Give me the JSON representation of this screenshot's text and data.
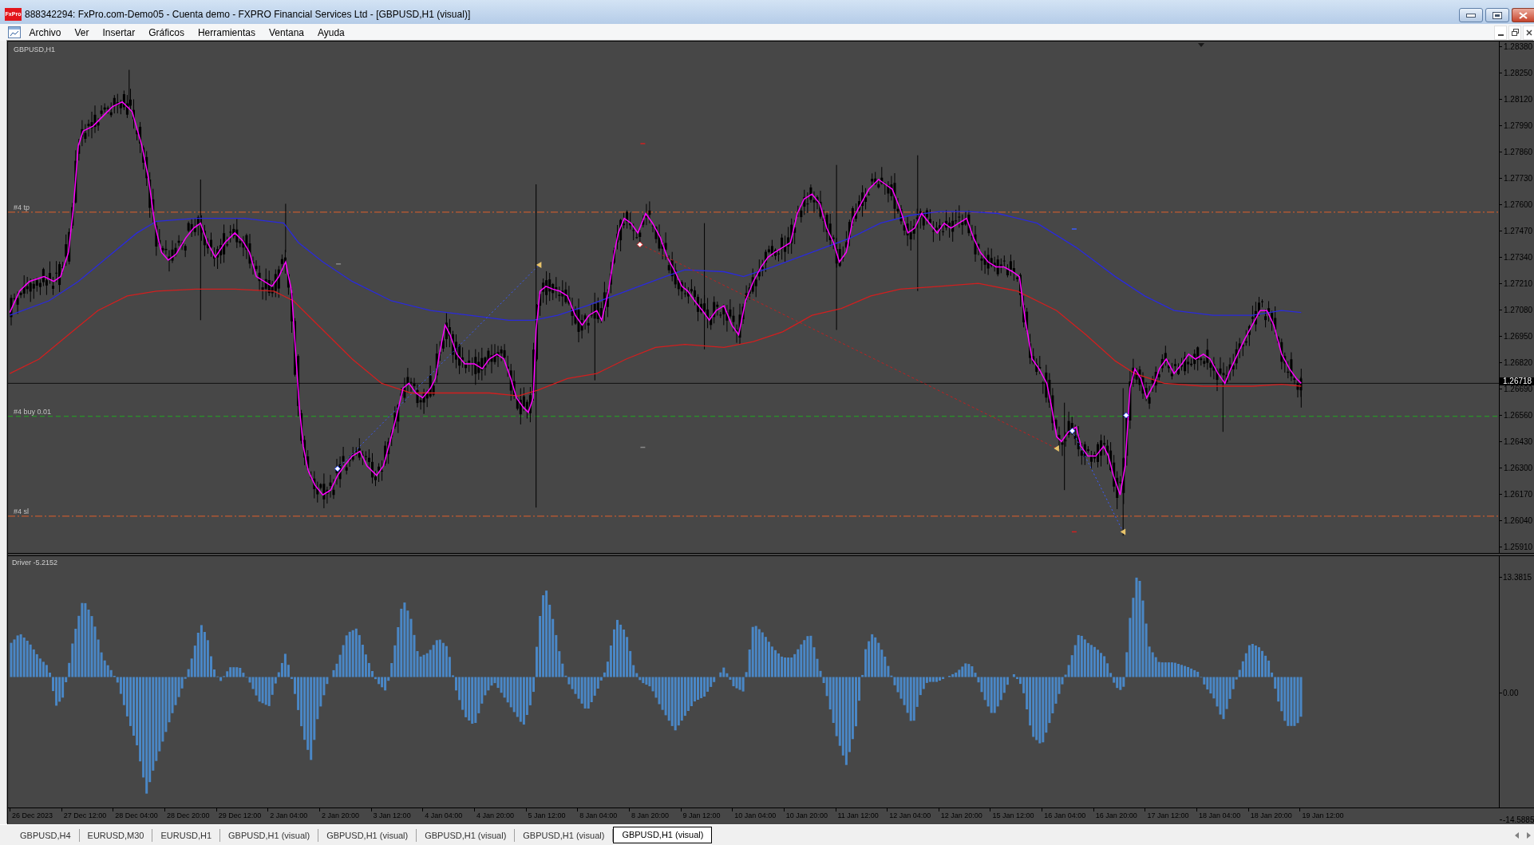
{
  "window": {
    "logo_text": "FxPro",
    "title": "888342294: FxPro.com-Demo05 - Cuenta demo - FXPRO Financial Services Ltd - [GBPUSD,H1 (visual)]"
  },
  "menu": [
    "Archivo",
    "Ver",
    "Insertar",
    "Gráficos",
    "Herramientas",
    "Ventana",
    "Ayuda"
  ],
  "chart": {
    "symbol_label": "GBPUSD,H1",
    "order_lines": [
      {
        "kind": "tp",
        "label": "#4 tp"
      },
      {
        "kind": "entry",
        "label": "#4 buy 0.01"
      },
      {
        "kind": "sl",
        "label": "#4 sl"
      }
    ],
    "price_axis": [
      "1.28380",
      "1.28250",
      "1.28120",
      "1.27990",
      "1.27860",
      "1.27730",
      "1.27600",
      "1.27470",
      "1.27340",
      "1.27210",
      "1.27080",
      "1.26950",
      "1.26820",
      "1.26690",
      "1.26560",
      "1.26430",
      "1.26300",
      "1.26170",
      "1.26040",
      "1.25910"
    ],
    "current_price": "1.26718",
    "indicator": {
      "label": "Driver -5.2152",
      "axis": [
        "13.3815",
        "0.00",
        "-14.5885"
      ]
    },
    "time_axis": [
      "26 Dec 2023",
      "27 Dec 12:00",
      "28 Dec 04:00",
      "28 Dec 20:00",
      "29 Dec 12:00",
      "2 Jan 04:00",
      "2 Jan 20:00",
      "3 Jan 12:00",
      "4 Jan 04:00",
      "4 Jan 20:00",
      "5 Jan 12:00",
      "8 Jan 04:00",
      "8 Jan 20:00",
      "9 Jan 12:00",
      "10 Jan 04:00",
      "10 Jan 20:00",
      "11 Jan 12:00",
      "12 Jan 04:00",
      "12 Jan 20:00",
      "15 Jan 12:00",
      "16 Jan 04:00",
      "16 Jan 20:00",
      "17 Jan 12:00",
      "18 Jan 04:00",
      "18 Jan 20:00",
      "19 Jan 12:00"
    ]
  },
  "tabs": [
    {
      "label": "GBPUSD,H4",
      "selected": false
    },
    {
      "label": "EURUSD,M30",
      "selected": false
    },
    {
      "label": "EURUSD,H1",
      "selected": false
    },
    {
      "label": "GBPUSD,H1 (visual)",
      "selected": false
    },
    {
      "label": "GBPUSD,H1 (visual)",
      "selected": false
    },
    {
      "label": "GBPUSD,H1 (visual)",
      "selected": false
    },
    {
      "label": "GBPUSD,H1 (visual)",
      "selected": false
    },
    {
      "label": "GBPUSD,H1 (visual)",
      "selected": true
    }
  ]
}
